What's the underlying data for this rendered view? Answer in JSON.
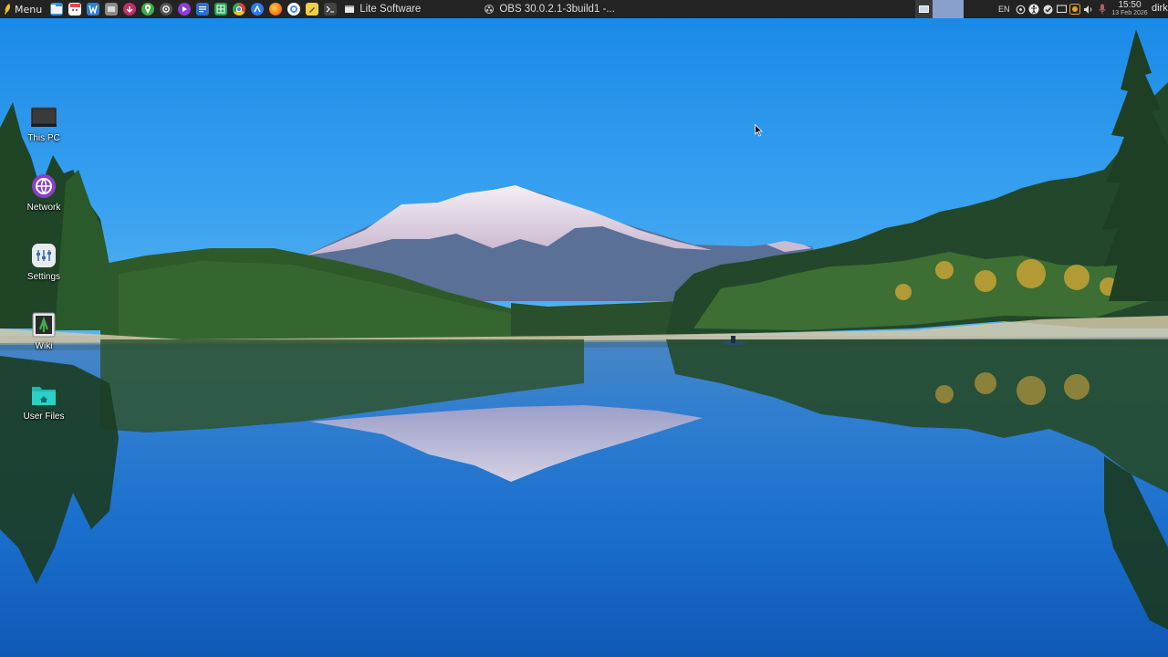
{
  "panel": {
    "menu_label": "Menu",
    "launchers": [
      {
        "icon": "file-manager-icon",
        "color": "#3b8fe0"
      },
      {
        "icon": "calendar-icon",
        "color": "#e04848"
      },
      {
        "icon": "text-editor-icon",
        "color": "#2e7fd4"
      },
      {
        "icon": "disk-utility-icon",
        "color": "#7a7a7a"
      },
      {
        "icon": "record-icon",
        "color": "#c0306a"
      },
      {
        "icon": "map-pin-icon",
        "color": "#3fae4a"
      },
      {
        "icon": "settings-gear-icon",
        "color": "#555555"
      },
      {
        "icon": "media-player-icon",
        "color": "#8b3fd0"
      },
      {
        "icon": "document-icon",
        "color": "#2d6fcc"
      },
      {
        "icon": "spreadsheet-icon",
        "color": "#21a355"
      },
      {
        "icon": "chrome-icon",
        "color": "#e0b020"
      },
      {
        "icon": "browser-icon",
        "color": "#2b7de9"
      },
      {
        "icon": "firefox-icon",
        "color": "#f07a20"
      },
      {
        "icon": "chromium-icon",
        "color": "#4a90e2"
      },
      {
        "icon": "notes-icon",
        "color": "#f0d040"
      },
      {
        "icon": "terminal-icon",
        "color": "#444444"
      }
    ],
    "tasks": [
      {
        "label": "Lite Software",
        "icon": "window-icon"
      },
      {
        "label": "OBS 30.0.2.1-3build1 -...",
        "icon": "obs-icon"
      }
    ],
    "tray": {
      "language": "EN",
      "icons": [
        "network-icon",
        "accessibility-icon",
        "shield-check-icon",
        "screen-icon",
        "updates-icon",
        "volume-icon",
        "microphone-icon"
      ]
    },
    "clock": {
      "time": "15:50",
      "date": "13 Feb 2026"
    },
    "user": "dirk"
  },
  "desktop_icons": [
    {
      "label": "This PC",
      "icon": "computer-icon"
    },
    {
      "label": "Network",
      "icon": "network-globe-icon"
    },
    {
      "label": "Settings",
      "icon": "settings-icon"
    },
    {
      "label": "Wiki",
      "icon": "wiki-icon"
    },
    {
      "label": "User Files",
      "icon": "home-folder-icon"
    }
  ]
}
